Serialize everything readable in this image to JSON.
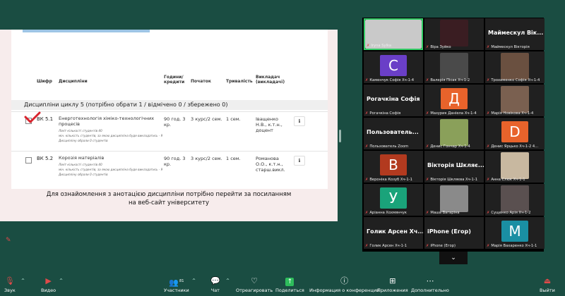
{
  "slide": {
    "columns": [
      "Шифр",
      "Дисципліни",
      "Години/ кредити",
      "Початок",
      "Тривалість",
      "Викладач (викладачі)"
    ],
    "group": "Дисципліни циклу 5 (потрібно обрати 1 / відмічено 0 / збережено 0)",
    "rows": [
      {
        "code": "ВК 5.1",
        "title": "Енерготехнологія хіміко-технологічних процесів",
        "note1": "Ліміт кількості студентів 40",
        "note2": "мін. кількість студентів, за якою дисципліна буде викладатись - 9",
        "note3": "Дисципліну обрали 0 студентів",
        "hours": "90 год. 3 кр.",
        "start": "3 курс/2 сем.",
        "duration": "1 сем.",
        "teacher": "Іващенко Н.В., к.т.н., доцент"
      },
      {
        "code": "ВК 5.2",
        "title": "Корозія матеріалів",
        "note1": "Ліміт кількості студентів 40",
        "note2": "мін. кількість студентів, за якою дисципліна буде викладатись - 9",
        "note3": "Дисципліну обрали 0 студентів",
        "hours": "90 год. 3 кр.",
        "start": "3 курс/2 сем.",
        "duration": "1 сем.",
        "teacher": "Романова О.О., к.т.н., старш.викл."
      }
    ],
    "caption_line1": "Для ознайомлення з анотацією дисципліни потрібно перейти за посиланням",
    "caption_line2": "на веб-сайт університету"
  },
  "participants": [
    {
      "name": "Iryna Sylka",
      "type": "photo",
      "color": "#c9c9c9",
      "active": true
    },
    {
      "name": "Віра Зуйко",
      "type": "photo",
      "color": "#3a1d22"
    },
    {
      "name": "Маймескул Вікторія",
      "type": "text",
      "big": "Маймескул  Вік..."
    },
    {
      "name": "Каменчук Софія Хч-1-4",
      "type": "avatar",
      "letter": "С",
      "color": "#6a3fc7"
    },
    {
      "name": "Валерія Пісак Хч-1-2",
      "type": "photo",
      "color": "#4a4a4a"
    },
    {
      "name": "Трохименко Софія Хч-1-4",
      "type": "photo",
      "color": "#6a5040"
    },
    {
      "name": "Рогачкіна Софія",
      "type": "text",
      "big": "Рогачкіна Софія"
    },
    {
      "name": "Мазурик Даніела Хч-1-4",
      "type": "avatar",
      "letter": "Д",
      "color": "#e8632b"
    },
    {
      "name": "Марія Новікова Хч-1-4",
      "type": "photo",
      "color": "#7a6050"
    },
    {
      "name": "Пользователь Zoom",
      "type": "text",
      "big": "Пользователь..."
    },
    {
      "name": "Денис Гончар Хч-1-4",
      "type": "photo",
      "color": "#8aa05a"
    },
    {
      "name": "Денис Ярцько Хч-1-2 4...",
      "type": "avatar",
      "letter": "D",
      "color": "#e8632b"
    },
    {
      "name": "Вероніка Козуб Хч-1-1",
      "type": "avatar",
      "letter": "В",
      "color": "#b23a1f"
    },
    {
      "name": "Вікторія Шкляєва Хч-1-1",
      "type": "text",
      "big": "Вікторія  Шкляє..."
    },
    {
      "name": "Анна Слюк Хч-1-1",
      "type": "photo",
      "color": "#c8b8a0"
    },
    {
      "name": "Аріанна Хохмянчук",
      "type": "avatar",
      "letter": "У",
      "color": "#1aa37a"
    },
    {
      "name": "Маша Вагаріна",
      "type": "photo",
      "color": "#8a8a8a"
    },
    {
      "name": "Сущенко Арія Хч-1-2",
      "type": "photo",
      "color": "#5a5050"
    },
    {
      "name": "Голик Арсен Хч-1-1",
      "type": "text",
      "big": "Голик  Арсен  Хч..."
    },
    {
      "name": "iPhone (Егор)",
      "type": "text",
      "big": "iPhone (Егор)"
    },
    {
      "name": "Марія Вахаренко Хч-1-1",
      "type": "avatar",
      "letter": "M",
      "color": "#1a8fa3"
    }
  ],
  "toolbar": {
    "audio": "Звук",
    "video": "Видео",
    "participants": "Участники",
    "participants_count": "81",
    "chat": "Чат",
    "reactions": "Отреагировать",
    "share": "Поделиться",
    "info": "Информация о конференции",
    "apps": "Приложения",
    "more": "Дополнительно",
    "leave": "Выйти"
  },
  "colors": {
    "background": "#1a4d42",
    "share_green": "#2ebd5c",
    "active_border": "#33cc66",
    "muted_red": "#e04a4a"
  }
}
